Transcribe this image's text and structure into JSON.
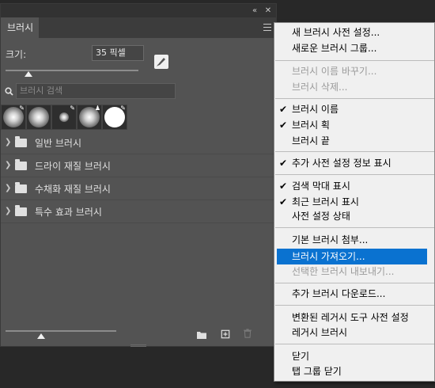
{
  "panel": {
    "tab_label": "브러시",
    "collapse_label": "«",
    "close_label": "✕",
    "size_label": "크기:",
    "size_value": "35 픽셀",
    "size_slider_fraction": 0.17,
    "search_placeholder": "브러시 검색",
    "brush_groups": [
      {
        "label": "일반 브러시"
      },
      {
        "label": "드라이 재질 브러시"
      },
      {
        "label": "수채화 재질 브러시"
      },
      {
        "label": "특수 효과 브러시"
      }
    ],
    "preview_slider_fraction": 0.32
  },
  "menu": {
    "items": {
      "new_preset": "새 브러시 사전 설정...",
      "new_group": "새로운 브러시 그룹...",
      "rename": "브러시 이름 바꾸기...",
      "delete": "브러시 삭제...",
      "brush_name": "브러시 이름",
      "brush_stroke": "브러시 획",
      "brush_tip": "브러시 끝",
      "show_extra_info": "추가 사전 설정 정보 표시",
      "show_search_bar": "검색 막대 표시",
      "show_recent": "최근 브러시 표시",
      "preset_status": "사전 설정 상태",
      "append_default": "기본 브러시 첨부...",
      "import_brushes": "브러시 가져오기...",
      "export_selected": "선택한 브러시 내보내기...",
      "get_more": "추가 브러시 다운로드...",
      "convert_legacy": "변환된 레거시 도구 사전 설정",
      "legacy_brushes": "레거시 브러시",
      "close": "닫기",
      "close_tab_group": "탭 그룹 닫기"
    },
    "check_mark": "✔",
    "highlight_color": "#0a72d0"
  }
}
